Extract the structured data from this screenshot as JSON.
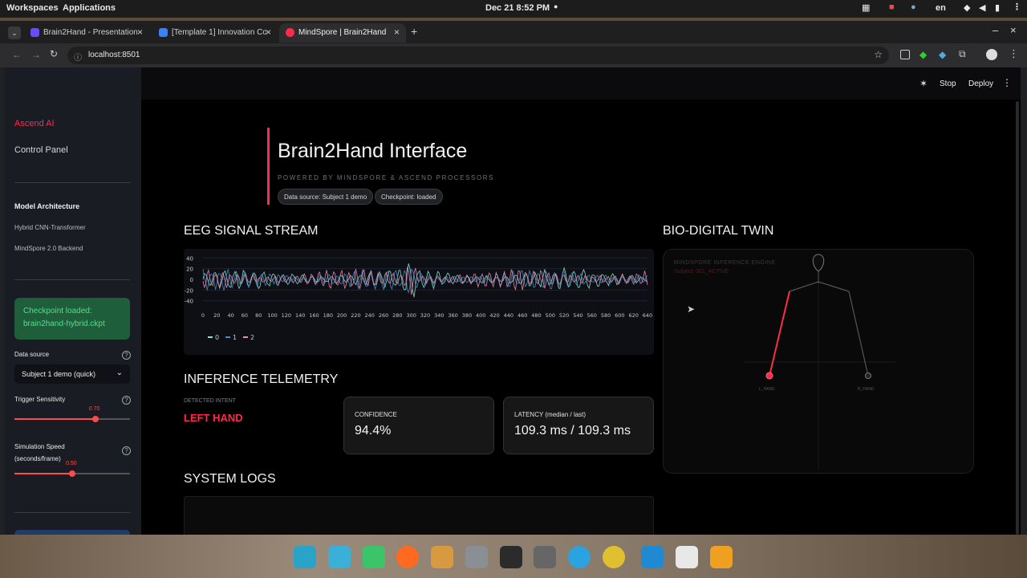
{
  "system": {
    "workspaces": "Workspaces",
    "applications": "Applications",
    "clock": "Dec 21  8:52 PM",
    "lang": "en"
  },
  "browser": {
    "tabs": [
      {
        "title": "Brain2Hand - Presentation",
        "color": "#6a4cff"
      },
      {
        "title": "[Template 1] Innovation Con",
        "color": "#3b82f6"
      },
      {
        "title": "MindSpore | Brain2Hand",
        "color": "#ff2b4a"
      }
    ],
    "url": "localhost:8501"
  },
  "header": {
    "stop": "Stop",
    "deploy": "Deploy"
  },
  "sidebar": {
    "brand": "Ascend AI",
    "control_panel": "Control Panel",
    "model_arch": "Model Architecture",
    "arch_items": [
      "Hybrid CNN-Transformer",
      "MindSpore 2.0 Backend"
    ],
    "checkpoint_msg": "Checkpoint loaded: brain2hand-hybrid.ckpt",
    "data_source_label": "Data source",
    "data_source_value": "Subject 1 demo (quick)",
    "trigger_label": "Trigger Sensitivity",
    "trigger_value": 0.7,
    "trigger_value_text": "0.70",
    "speed_label": "Simulation Speed (seconds/frame)",
    "speed_value": 0.5,
    "speed_value_text": "0.50"
  },
  "hero": {
    "title": "Brain2Hand Interface",
    "subtitle": "POWERED BY MINDSPORE & ASCEND PROCESSORS",
    "chips": [
      "Data source: Subject 1 demo",
      "Checkpoint: loaded"
    ]
  },
  "eeg": {
    "title": "EEG SIGNAL STREAM",
    "legend": [
      "0",
      "1",
      "2"
    ]
  },
  "chart_data": {
    "type": "line",
    "x_ticks": [
      0,
      20,
      40,
      60,
      80,
      100,
      120,
      140,
      160,
      180,
      200,
      220,
      240,
      260,
      280,
      300,
      320,
      340,
      360,
      380,
      400,
      420,
      440,
      460,
      480,
      500,
      520,
      540,
      560,
      580,
      600,
      620,
      640
    ],
    "y_ticks": [
      40,
      20,
      0,
      -20,
      -40
    ],
    "xlim": [
      0,
      640
    ],
    "ylim": [
      -45,
      45
    ],
    "series": [
      {
        "name": "0",
        "color": "#8fe3c8"
      },
      {
        "name": "1",
        "color": "#3b8fd6"
      },
      {
        "name": "2",
        "color": "#f08ab0"
      }
    ]
  },
  "twin": {
    "title": "BIO-DIGITAL TWIN",
    "engine": "MINDSPORE INFERENCE ENGINE",
    "subject": "Subject: 001_ACTIVE",
    "l_hand": "L_HAND",
    "r_hand": "R_HAND"
  },
  "telemetry": {
    "title": "INFERENCE TELEMETRY",
    "intent_label": "DETECTED INTENT",
    "intent": "LEFT HAND",
    "confidence_label": "CONFIDENCE",
    "confidence": "94.4%",
    "latency_label": "LATENCY (median / last)",
    "latency": "109.3 ms / 109.3 ms"
  },
  "logs": {
    "title": "SYSTEM LOGS"
  },
  "colors": {
    "accent": "#ff2b4a",
    "success_bg": "#1f5e3a",
    "success_text": "#4ee08a"
  }
}
